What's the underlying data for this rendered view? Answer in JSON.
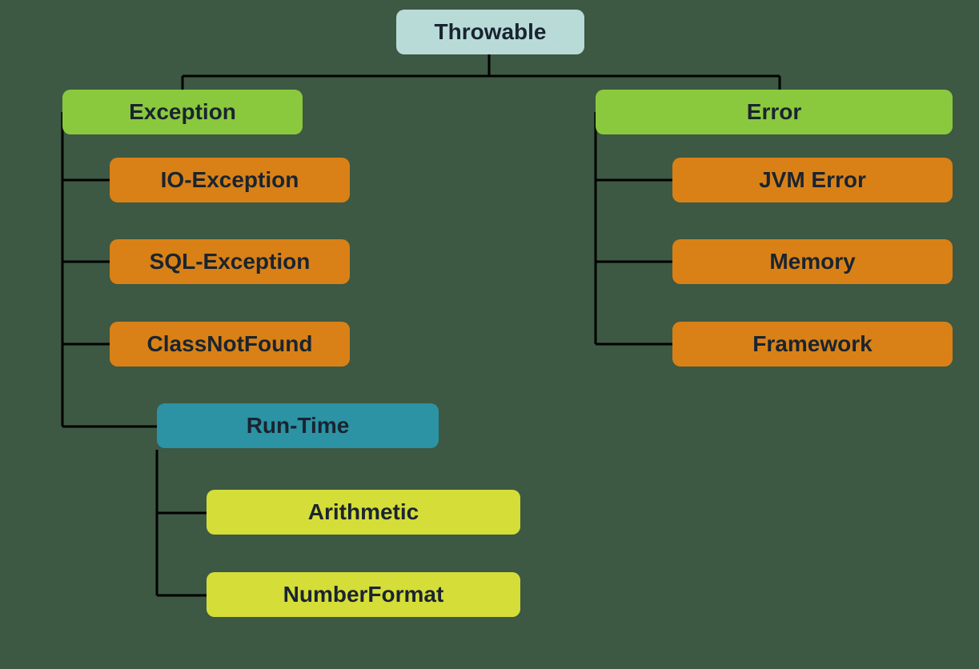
{
  "root": {
    "label": "Throwable"
  },
  "exception": {
    "label": "Exception",
    "children": {
      "io": "IO-Exception",
      "sql": "SQL-Exception",
      "cnf": "ClassNotFound",
      "runtime": {
        "label": "Run-Time",
        "children": {
          "arith": "Arithmetic",
          "numf": "NumberFormat"
        }
      }
    }
  },
  "error": {
    "label": "Error",
    "children": {
      "jvm": "JVM Error",
      "mem": "Memory",
      "fw": "Framework"
    }
  }
}
